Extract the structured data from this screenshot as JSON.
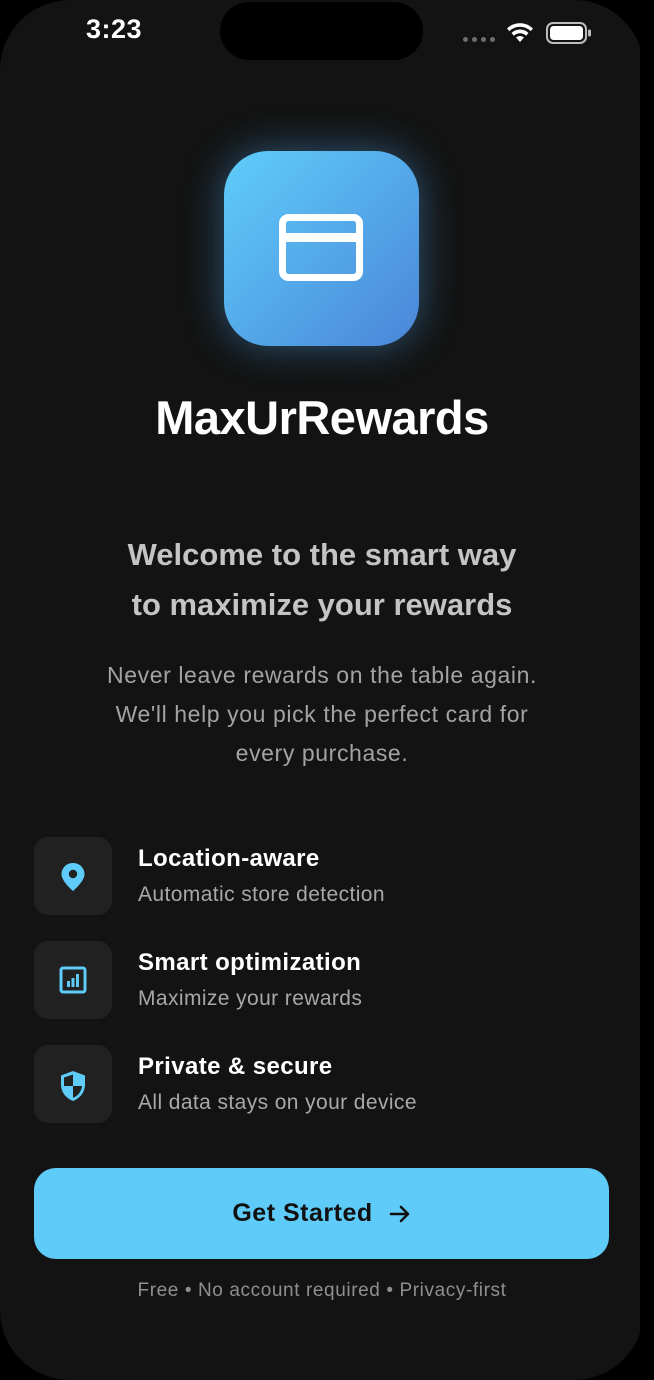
{
  "status_bar": {
    "time": "3:23"
  },
  "app": {
    "name": "MaxUrRewards",
    "icon": "credit-card-icon"
  },
  "welcome": {
    "line1": "Welcome to the smart way",
    "line2": "to maximize your rewards",
    "sub_line1": "Never leave rewards on the table again.",
    "sub_line2": "We'll help you pick the perfect card for",
    "sub_line3": "every purchase."
  },
  "features": [
    {
      "icon": "location-pin-icon",
      "title": "Location-aware",
      "description": "Automatic store detection"
    },
    {
      "icon": "chart-icon",
      "title": "Smart optimization",
      "description": "Maximize your rewards"
    },
    {
      "icon": "shield-icon",
      "title": "Private & secure",
      "description": "All data stays on your device"
    }
  ],
  "cta": {
    "label": "Get Started",
    "icon": "arrow-right-icon"
  },
  "footnote": "Free • No account required • Privacy-first",
  "colors": {
    "background": "#131313",
    "accent": "#5ecbf8",
    "icon_gradient_start": "#5fcdfb",
    "icon_gradient_end": "#4a86d8",
    "feature_box": "#212121"
  }
}
